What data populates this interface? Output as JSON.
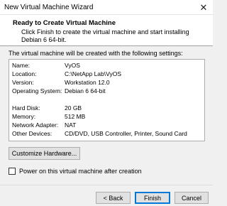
{
  "window": {
    "title": "New Virtual Machine Wizard",
    "close_glyph": "✕"
  },
  "header": {
    "title": "Ready to Create Virtual Machine",
    "description": "Click Finish to create the virtual machine and start installing Debian 6 64-bit."
  },
  "intro": "The virtual machine will be created with the following settings:",
  "settings": [
    {
      "key": "Name:",
      "value": "VyOS"
    },
    {
      "key": "Location:",
      "value": "C:\\NetApp Lab\\VyOS"
    },
    {
      "key": "Version:",
      "value": "Workstation 12.0"
    },
    {
      "key": "Operating System:",
      "value": "Debian 6 64-bit"
    },
    {
      "key": "Hard Disk:",
      "value": "20 GB"
    },
    {
      "key": "Memory:",
      "value": "512 MB"
    },
    {
      "key": "Network Adapter:",
      "value": "NAT"
    },
    {
      "key": "Other Devices:",
      "value": "CD/DVD, USB Controller, Printer, Sound Card"
    }
  ],
  "buttons": {
    "customize": "Customize Hardware...",
    "back": "< Back",
    "finish": "Finish",
    "cancel": "Cancel"
  },
  "checkbox": {
    "label": "Power on this virtual machine after creation",
    "checked": false
  },
  "colors": {
    "accent": "#0078d7"
  }
}
